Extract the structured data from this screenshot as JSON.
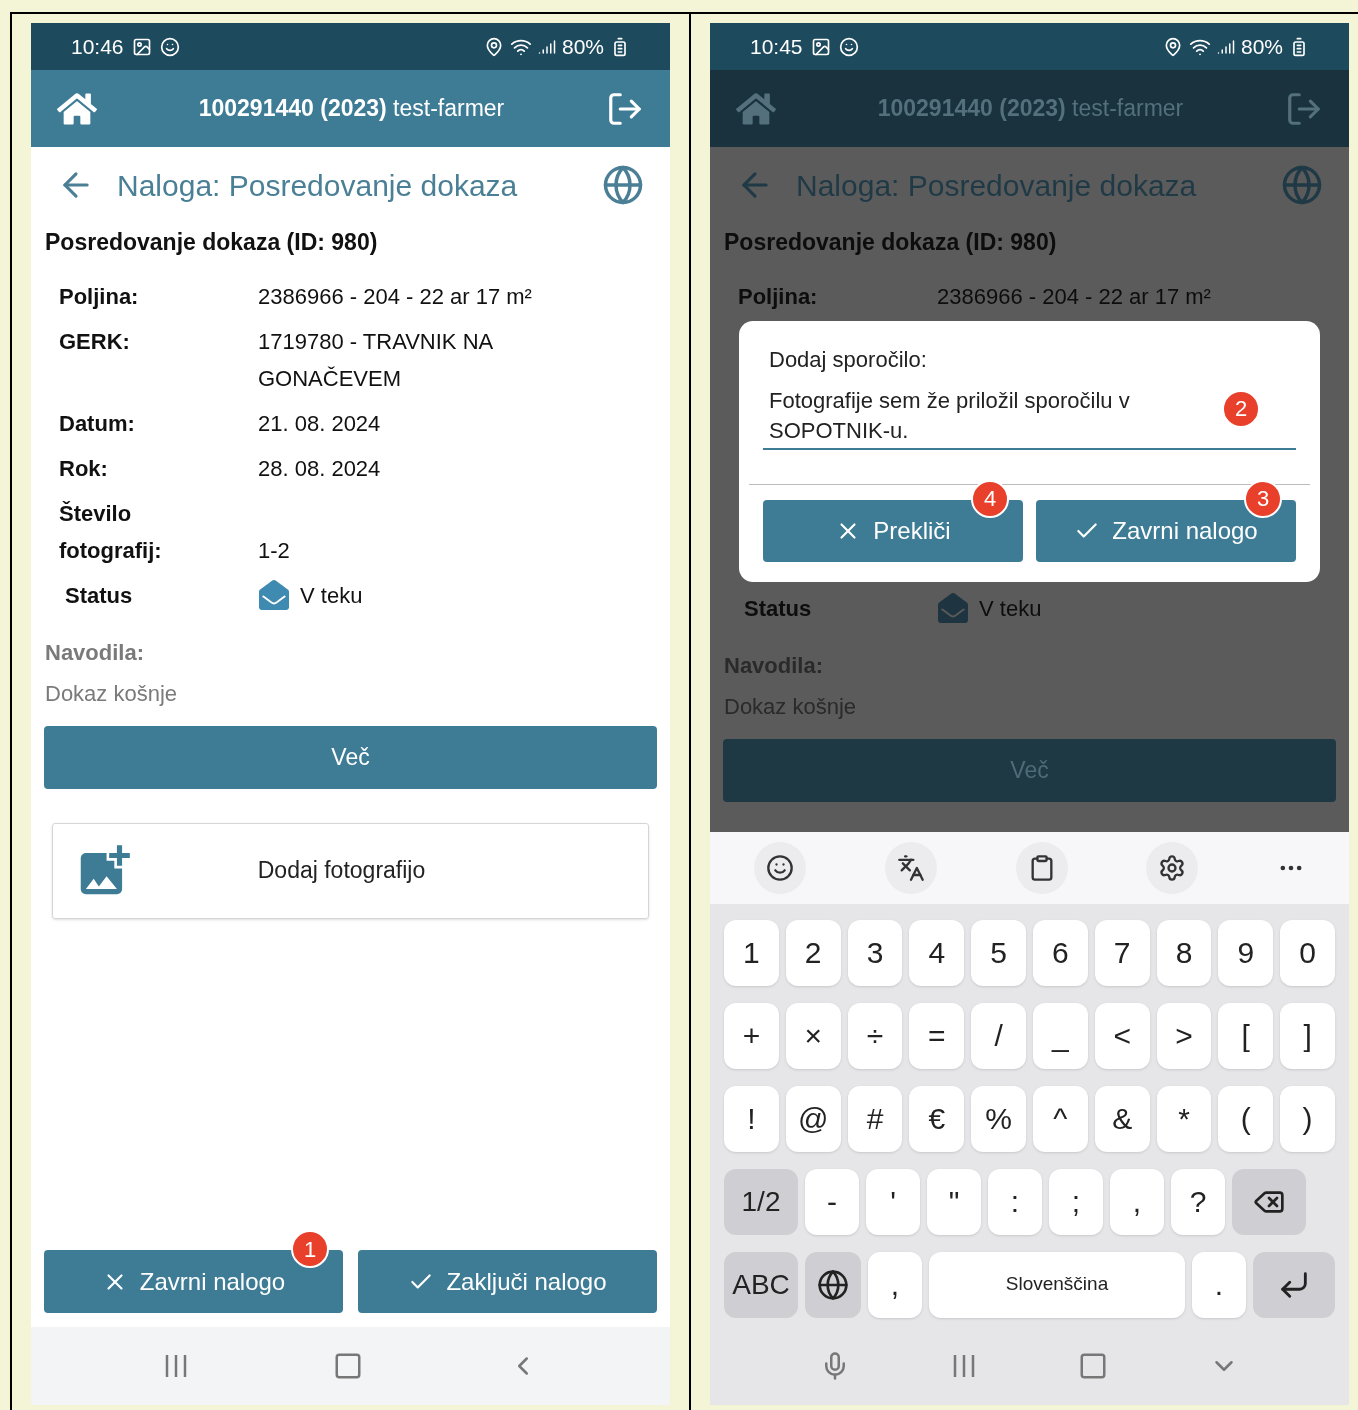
{
  "screens": [
    {
      "dimmed": false,
      "status_bar": {
        "time": "10:46",
        "battery": "80%"
      },
      "header": {
        "account": "100291440 (2023)",
        "user": "test-farmer"
      },
      "page_title": "Naloga: Posredovanje dokaza",
      "heading": "Posredovanje dokaza (ID: 980)",
      "fields": [
        {
          "kind": "text",
          "label": "Poljina:",
          "value": "2386966 - 204 - 22 ar 17 m²"
        },
        {
          "kind": "text",
          "label": "GERK:",
          "value": "1719780 - TRAVNIK NA GONAČEVEM"
        },
        {
          "kind": "text",
          "label": "Datum:",
          "value": "21. 08. 2024"
        },
        {
          "kind": "text",
          "label": "Rok:",
          "value": "28. 08. 2024"
        },
        {
          "kind": "text",
          "label": "Število fotografij:",
          "value": "1-2"
        },
        {
          "kind": "status",
          "label": "Status",
          "value": "V teku"
        }
      ],
      "instructions": {
        "label": "Navodila:",
        "text": "Dokaz košnje"
      },
      "more_button": "Več",
      "add_photo": "Dodaj fotografijo",
      "footer_buttons": [
        {
          "kind": "cancel",
          "label": "Zavrni nalogo",
          "badge": "1"
        },
        {
          "kind": "confirm",
          "label": "Zaključi nalogo"
        }
      ],
      "nav_bar": [
        {
          "kind": "recent"
        },
        {
          "kind": "home"
        },
        {
          "kind": "back"
        }
      ]
    },
    {
      "dimmed": true,
      "status_bar": {
        "time": "10:45",
        "battery": "80%"
      },
      "header": {
        "account": "100291440 (2023)",
        "user": "test-farmer"
      },
      "page_title": "Naloga: Posredovanje dokaza",
      "heading": "Posredovanje dokaza (ID: 980)",
      "fields": [
        {
          "kind": "text",
          "label": "Poljina:",
          "value": "2386966 - 204 - 22 ar 17 m²"
        },
        {
          "kind": "status",
          "label": "Status",
          "value": "V teku"
        }
      ],
      "dialog": {
        "label": "Dodaj sporočilo:",
        "value": "Fotografije sem že priložil sporočilu v SOPOTNIK-u.",
        "badge": "2",
        "buttons": [
          {
            "kind": "cancel",
            "label": "Prekliči",
            "badge": "4"
          },
          {
            "kind": "confirm",
            "label": "Zavrni nalogo",
            "badge": "3"
          }
        ]
      },
      "instructions": {
        "label": "Navodila:",
        "text": "Dokaz košnje"
      },
      "more_button": "Več",
      "keyboard": {
        "rows": [
          {
            "keys": [
              {
                "kind": "char",
                "label": "1"
              },
              {
                "kind": "char",
                "label": "2"
              },
              {
                "kind": "char",
                "label": "3"
              },
              {
                "kind": "char",
                "label": "4"
              },
              {
                "kind": "char",
                "label": "5"
              },
              {
                "kind": "char",
                "label": "6"
              },
              {
                "kind": "char",
                "label": "7"
              },
              {
                "kind": "char",
                "label": "8"
              },
              {
                "kind": "char",
                "label": "9"
              },
              {
                "kind": "char",
                "label": "0"
              }
            ]
          },
          {
            "keys": [
              {
                "kind": "char",
                "label": "+"
              },
              {
                "kind": "char",
                "label": "×"
              },
              {
                "kind": "char",
                "label": "÷"
              },
              {
                "kind": "char",
                "label": "="
              },
              {
                "kind": "char",
                "label": "/"
              },
              {
                "kind": "char",
                "label": "_"
              },
              {
                "kind": "char",
                "label": "<"
              },
              {
                "kind": "char",
                "label": ">"
              },
              {
                "kind": "char",
                "label": "["
              },
              {
                "kind": "char",
                "label": "]"
              }
            ]
          },
          {
            "keys": [
              {
                "kind": "char",
                "label": "!"
              },
              {
                "kind": "char",
                "label": "@"
              },
              {
                "kind": "char",
                "label": "#"
              },
              {
                "kind": "char",
                "label": "€"
              },
              {
                "kind": "char",
                "label": "%"
              },
              {
                "kind": "char",
                "label": "^"
              },
              {
                "kind": "char",
                "label": "&"
              },
              {
                "kind": "char",
                "label": "*"
              },
              {
                "kind": "char",
                "label": "("
              },
              {
                "kind": "char",
                "label": ")"
              }
            ]
          },
          {
            "keys": [
              {
                "kind": "mod",
                "label": "1/2"
              },
              {
                "kind": "char",
                "label": "-"
              },
              {
                "kind": "char",
                "label": "'"
              },
              {
                "kind": "char",
                "label": "\""
              },
              {
                "kind": "char",
                "label": ":"
              },
              {
                "kind": "char",
                "label": ";"
              },
              {
                "kind": "char",
                "label": ","
              },
              {
                "kind": "char",
                "label": "?"
              },
              {
                "kind": "backspace"
              }
            ]
          },
          {
            "keys": [
              {
                "kind": "mod",
                "label": "ABC"
              },
              {
                "kind": "globe"
              },
              {
                "kind": "char",
                "label": ","
              },
              {
                "kind": "space",
                "label": "Slovenščina"
              },
              {
                "kind": "char",
                "label": "."
              },
              {
                "kind": "enter"
              }
            ]
          }
        ]
      },
      "nav_bar": [
        {
          "kind": "mic"
        },
        {
          "kind": "recent"
        },
        {
          "kind": "home"
        },
        {
          "kind": "hide"
        }
      ]
    }
  ]
}
